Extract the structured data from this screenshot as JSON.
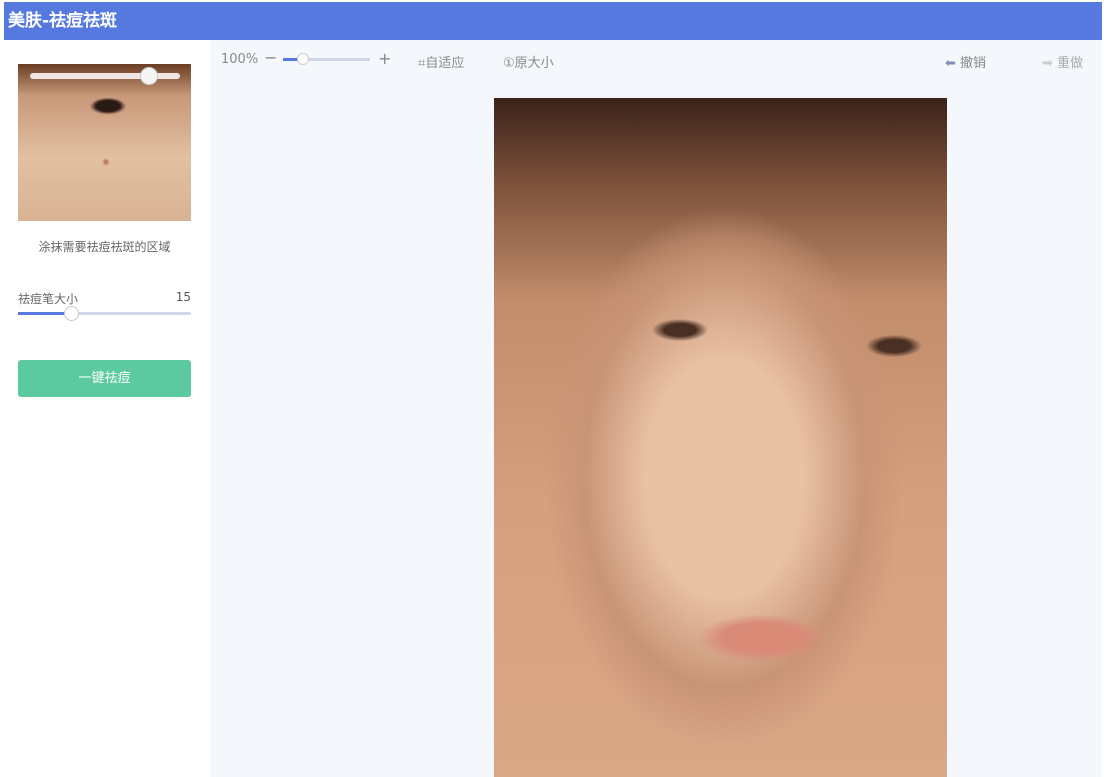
{
  "header": {
    "title": "美肤-祛痘祛斑"
  },
  "sidebar": {
    "hint": "涂抹需要祛痘祛斑的区域",
    "brush_label": "祛痘笔大小",
    "brush_value": "15",
    "brush_fraction": 0.3,
    "action_button": "一键祛痘"
  },
  "toolbar": {
    "zoom": "100%",
    "zoom_out": "−",
    "zoom_in": "+",
    "fit": "自适应",
    "original": "原大小",
    "undo": "撤销",
    "redo": "重做"
  },
  "colors": {
    "brand": "#5679e0",
    "action": "#5ccaa0"
  }
}
